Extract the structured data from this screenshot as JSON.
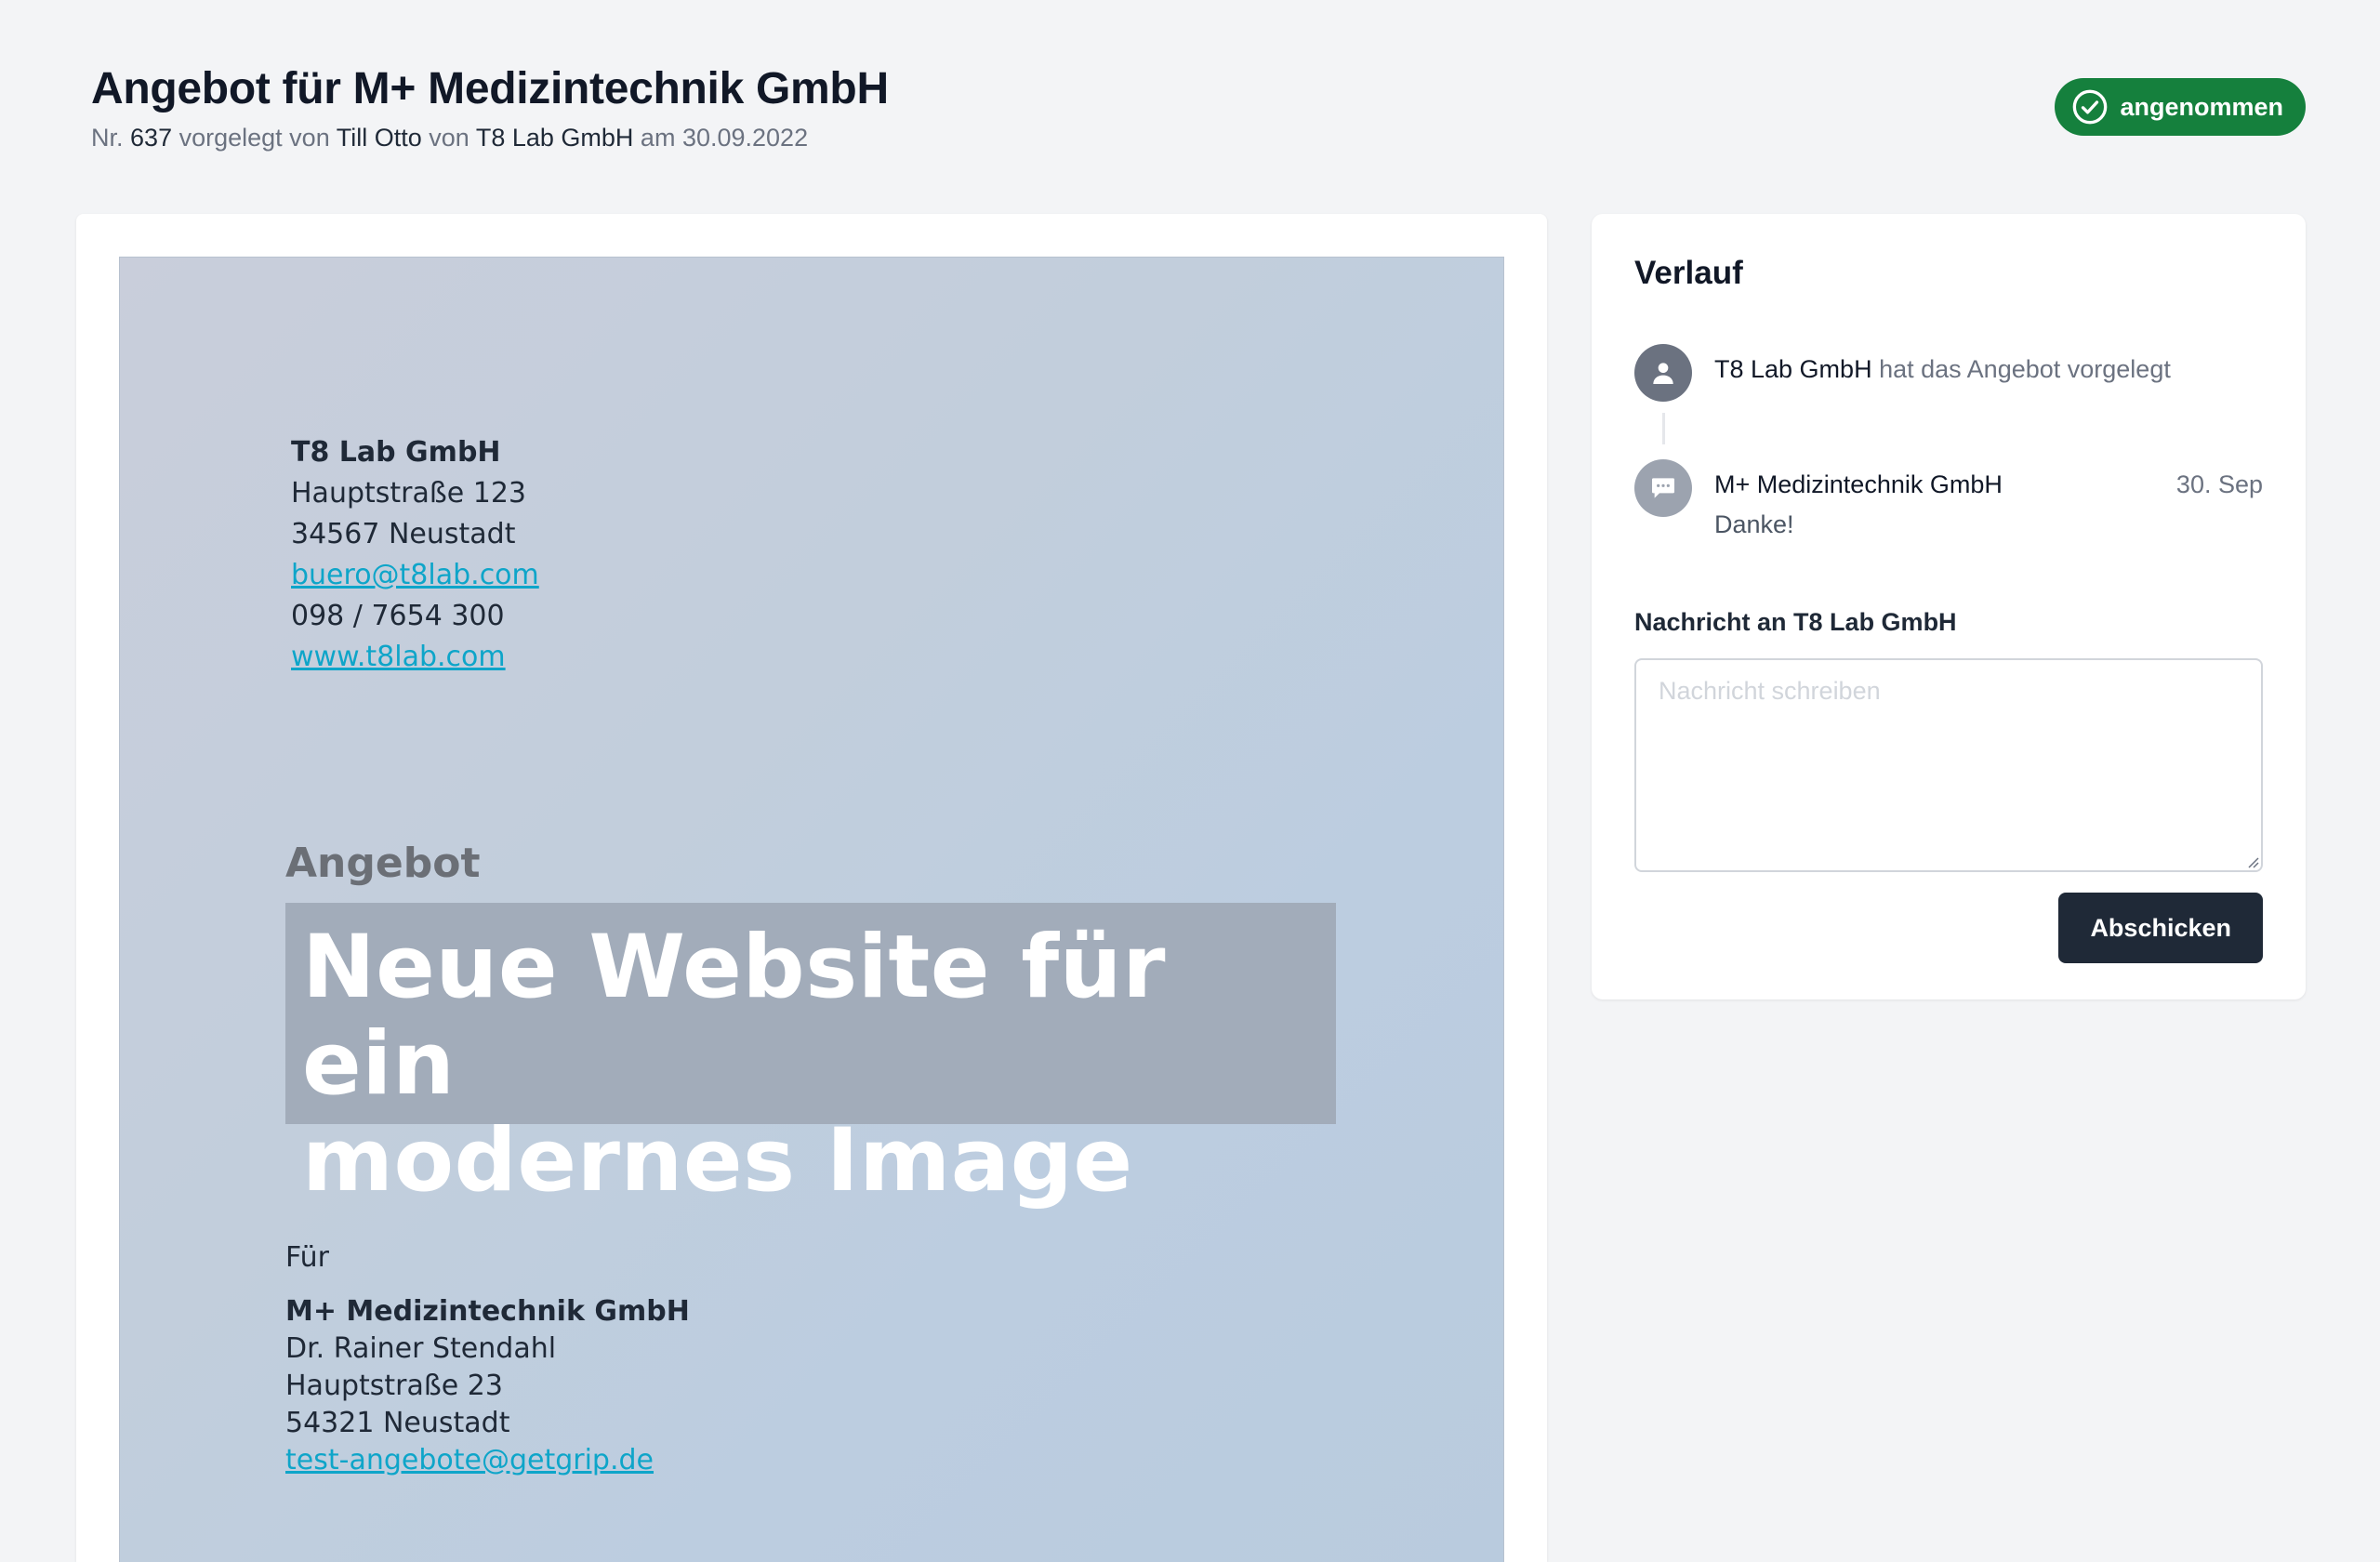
{
  "header": {
    "title": "Angebot für M+ Medizintechnik GmbH",
    "subtitle": {
      "nr_prefix": "Nr.",
      "nr": "637",
      "presented_by_label": "vorgelegt von",
      "presenter": "Till Otto",
      "from_label": "von",
      "company": "T8 Lab GmbH",
      "date_label": "am",
      "date": "30.09.2022"
    },
    "status": "angenommen"
  },
  "document": {
    "sender": {
      "name": "T8 Lab GmbH",
      "street": "Hauptstraße 123",
      "city": "34567 Neustadt",
      "email": "buero@t8lab.com",
      "phone": "098 / 7654 300",
      "website": "www.t8lab.com"
    },
    "kicker": "Angebot",
    "headline_line1": "Neue Website für ein",
    "headline_line2": "modernes Image",
    "recipient_label": "Für",
    "recipient": {
      "name": "M+ Medizintechnik GmbH",
      "contact": "Dr. Rainer Stendahl",
      "street": "Hauptstraße 23",
      "city": "54321 Neustadt",
      "email": "test-angebote@getgrip.de"
    }
  },
  "sidebar": {
    "title": "Verlauf",
    "timeline": [
      {
        "actor": "T8 Lab GmbH",
        "action": "hat das Angebot vorgelegt",
        "icon": "user-icon"
      },
      {
        "actor": "M+ Medizintechnik GmbH",
        "date": "30. Sep",
        "message": "Danke!",
        "icon": "chat-icon"
      }
    ],
    "message_label": "Nachricht an T8 Lab GmbH",
    "message_placeholder": "Nachricht schreiben",
    "send_label": "Abschicken"
  },
  "colors": {
    "status_green": "#15803d",
    "button_dark": "#1f2937",
    "link": "#0ea5c9"
  }
}
